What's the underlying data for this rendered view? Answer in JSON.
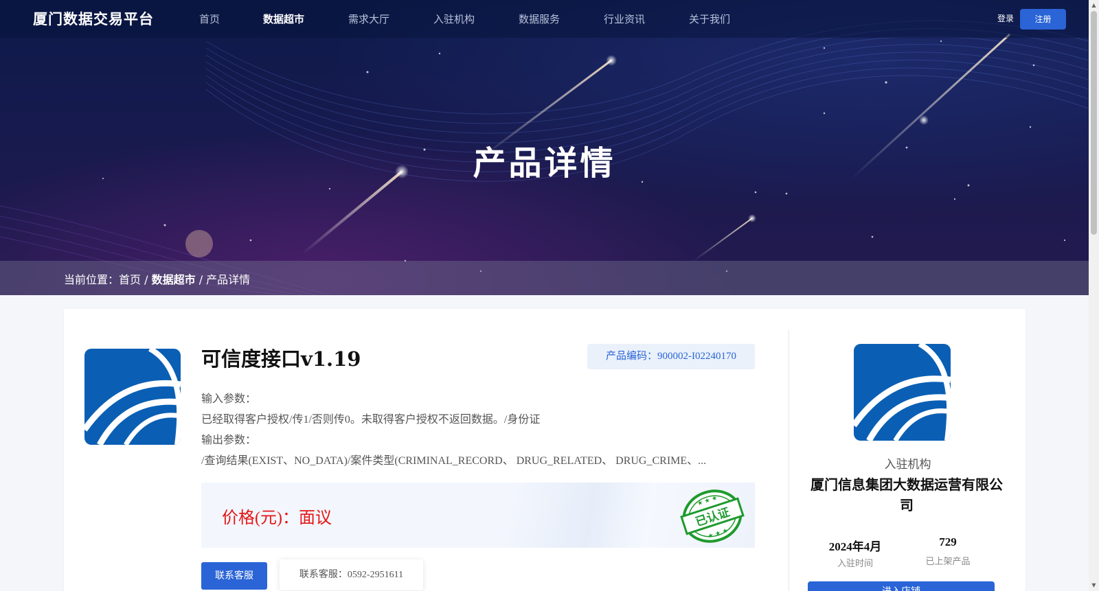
{
  "site": {
    "logo": "厦门数据交易平台"
  },
  "nav": {
    "items": [
      "首页",
      "数据超市",
      "需求大厅",
      "入驻机构",
      "数据服务",
      "行业资讯",
      "关于我们"
    ],
    "active_index": 1,
    "login": "登录",
    "register": "注册"
  },
  "hero": {
    "title": "产品详情"
  },
  "breadcrumb": {
    "prefix": "当前位置：",
    "home": "首页",
    "sep1": " / ",
    "category": "数据超市",
    "sep2": " / ",
    "current": "产品详情"
  },
  "product": {
    "title": "可信度接口v1.19",
    "code": "产品编码：900002-I02240170",
    "input_label": "输入参数：",
    "input_value": "已经取得客户授权/传1/否则传0。未取得客户授权不返回数据。/身份证",
    "output_label": "输出参数：",
    "output_value": "/查询结果(EXIST、NO_DATA)/案件类型(CRIMINAL_RECORD、 DRUG_RELATED、 DRUG_CRIME、...",
    "price": "价格(元)：面议",
    "certified_seal": "已认证",
    "contact_button": "联系客服",
    "contact_tip": "联系客服：0592-2951611"
  },
  "organization": {
    "caption": "入驻机构",
    "name": "厦门信息集团大数据运营有限公司",
    "join_date": "2024年4月",
    "join_date_label": "入驻时间",
    "product_count": "729",
    "product_count_label": "已上架产品",
    "enter_button": "进入店铺"
  },
  "colors": {
    "primary": "#2a64d6",
    "price_red": "#e51515",
    "seal_green": "#1e9a2e",
    "logo_blue": "#0a5fb4"
  }
}
